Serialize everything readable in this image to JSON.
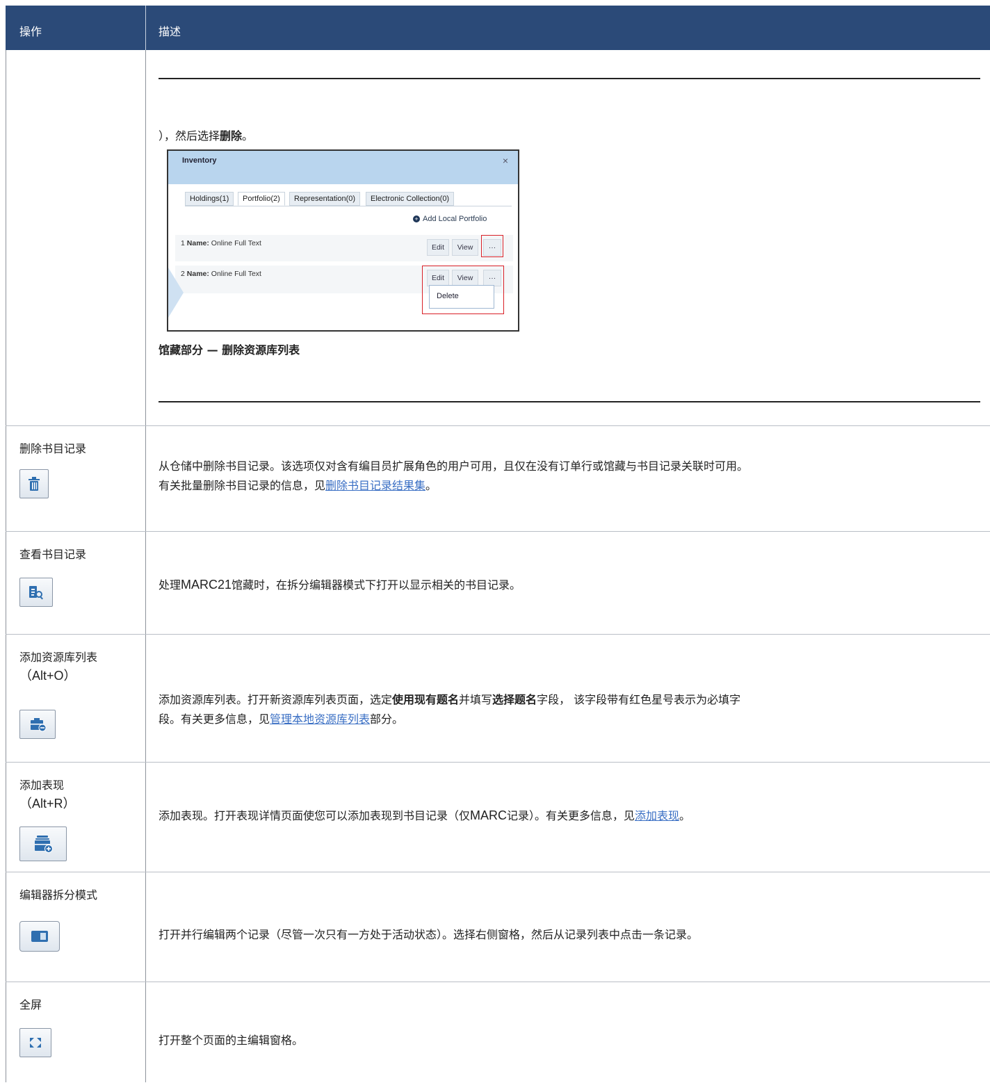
{
  "header": {
    "col_op": "操作",
    "col_desc": "描述"
  },
  "row0": {
    "text_before": "），然后选择",
    "text_bold": "删除",
    "text_after": "。",
    "caption": "馆藏部分 — 删除资源库列表",
    "screenshot": {
      "title": "Inventory",
      "close": "×",
      "tabs": [
        "Holdings(1)",
        "Portfolio(2)",
        "Representation(0)",
        "Electronic Collection(0)"
      ],
      "active_tab": "Portfolio(2)",
      "add_local": "Add Local Portfolio",
      "items": [
        {
          "num": "1",
          "label": "Name:",
          "value": "Online Full Text"
        },
        {
          "num": "2",
          "label": "Name:",
          "value": "Online Full Text"
        }
      ],
      "edit": "Edit",
      "view": "View",
      "more": "···",
      "delete": "Delete"
    }
  },
  "rows": {
    "delete_bib": {
      "op": "删除书目记录",
      "icon": "trash-icon",
      "desc1": "从仓储中删除书目记录。该选项仅对含有编目员扩展角色的用户可用，且仅在没有订单行或馆藏与书目记录关联时可用。",
      "desc2_pre": "有关批量删除书目记录的信息，见",
      "desc2_link": "删除书目记录结果集",
      "desc2_post": "。"
    },
    "view_bib": {
      "op": "查看书目记录",
      "icon": "record-search-icon",
      "desc_pre": "处理",
      "desc_lat": "MARC21",
      "desc_post": "馆藏时，在拆分编辑器模式下打开以显示相关的书目记录。"
    },
    "add_portfolio": {
      "op": "添加资源库列表",
      "shortcut": "（Alt+O）",
      "icon": "add-portfolio-icon",
      "d1": "添加资源库列表。打开新资源库列表页面，选定",
      "d1b": "使用现有题名",
      "d2": "并填写",
      "d2b": "选择题名",
      "d3": "字段， 该字段带有红色星号表示为必填字",
      "d4": "段。有关更多信息，见",
      "d4_link": "管理本地资源库列表",
      "d5": "部分。"
    },
    "add_representation": {
      "op": "添加表现",
      "shortcut": "（Alt+R）",
      "icon": "add-representation-icon",
      "d1": "添加表现。打开表现详情页面使您可以添加表现到书目记录（仅",
      "d1_lat": "MARC",
      "d2": "记录）。有关更多信息，见",
      "d2_link": "添加表现",
      "d3": "。"
    },
    "split_editor": {
      "op": "编辑器拆分模式",
      "icon": "split-pane-icon",
      "desc": "打开并行编辑两个记录（尽管一次只有一方处于活动状态）。选择右侧窗格，然后从记录列表中点击一条记录。"
    },
    "fullscreen": {
      "op": "全屏",
      "icon": "fullscreen-icon",
      "desc": "打开整个页面的主编辑窗格。"
    }
  },
  "colors": {
    "header_bg": "#2b4a78",
    "link": "#3a6fc4",
    "highlight": "#d91f26"
  }
}
